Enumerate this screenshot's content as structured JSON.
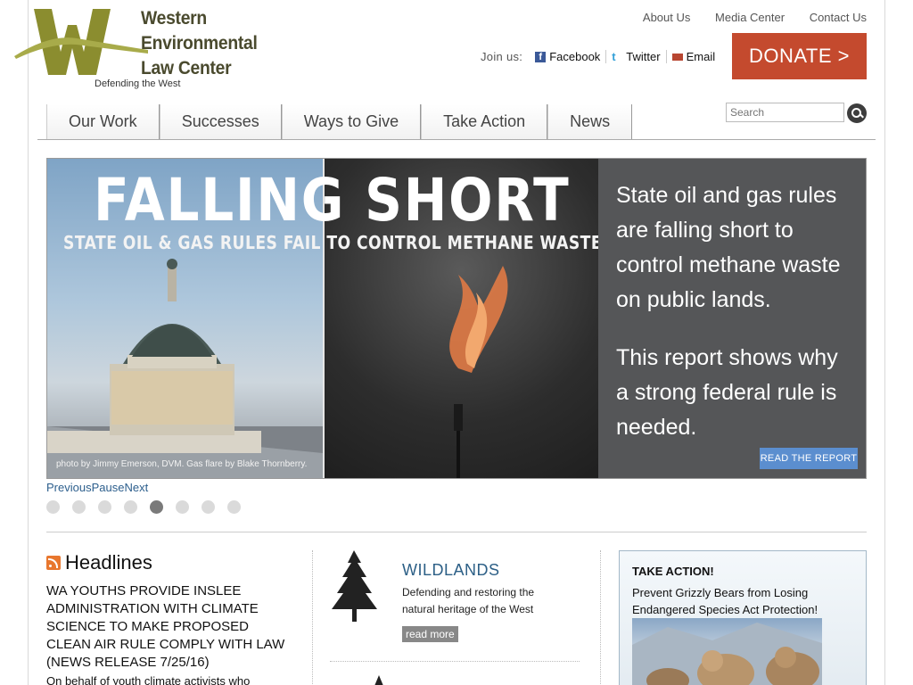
{
  "logo": {
    "line1": "Western",
    "line2": "Environmental",
    "line3": "Law Center",
    "tagline": "Defending the West",
    "brand_color": "#8b8d2f"
  },
  "toplinks": [
    "About Us",
    "Media Center",
    "Contact Us"
  ],
  "join": {
    "label": "Join us:",
    "facebook": "Facebook",
    "twitter": "Twitter",
    "email": "Email"
  },
  "donate": {
    "label": "DONATE >",
    "color": "#c44a2e"
  },
  "search": {
    "placeholder": "Search"
  },
  "nav": [
    "Our Work",
    "Successes",
    "Ways to Give",
    "Take Action",
    "News"
  ],
  "slider": {
    "headline": "FALLING SHORT",
    "subheadline": "STATE OIL & GAS RULES FAIL TO CONTROL METHANE WASTE",
    "credit": "photo by Jimmy Emerson, DVM. Gas flare by Blake Thornberry.",
    "text1": "State oil and gas rules are falling short to control methane waste on public lands.",
    "text2": "This report shows why a strong federal rule is needed.",
    "button": "READ THE REPORT",
    "controls": {
      "previous": "Previous",
      "pause": "Pause",
      "next": "Next"
    },
    "slide_count": 8,
    "active_slide": 5
  },
  "headlines": {
    "title": "Headlines",
    "item_title": "WA YOUTHS PROVIDE INSLEE ADMINISTRATION WITH CLIMATE SCIENCE TO MAKE PROPOSED CLEAN AIR RULE COMPLY WITH LAW (NEWS RELEASE 7/25/16)",
    "item_body": "On behalf of youth climate activists who"
  },
  "wildlands": {
    "title": "WILDLANDS",
    "description": "Defending and restoring the natural heritage of the West",
    "readmore": "read more"
  },
  "take_action": {
    "title": "TAKE ACTION!",
    "body": "Prevent Grizzly Bears from Losing Endangered Species Act Protection!"
  }
}
